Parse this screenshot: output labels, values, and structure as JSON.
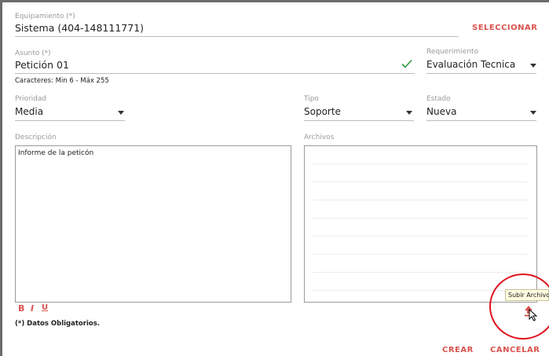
{
  "equipamiento": {
    "label": "Equipamiento (*)",
    "value": "Sistema (404-148111771)",
    "select_label": "SELECCIONAR"
  },
  "asunto": {
    "label": "Asunto (*)",
    "value": "Petición 01",
    "hint": "Caracteres: Min 6 - Máx 255"
  },
  "requerimiento": {
    "label": "Requerimiento",
    "value": "Evaluación Tecnica"
  },
  "prioridad": {
    "label": "Prioridad",
    "value": "Media"
  },
  "tipo": {
    "label": "Tipo",
    "value": "Soporte"
  },
  "estado": {
    "label": "Estado",
    "value": "Nueva"
  },
  "descripcion": {
    "label": "Descripción",
    "value": "Informe de la peticón"
  },
  "format": {
    "bold": "B",
    "italic": "I",
    "underline": "U"
  },
  "archivos": {
    "label": "Archivos"
  },
  "upload": {
    "tooltip": "Subir Archivo"
  },
  "footer": {
    "required_note": "(*) Datos Obligatorios.",
    "create_label": "CREAR",
    "cancel_label": "CANCELAR"
  },
  "colors": {
    "accent": "#d9534f",
    "check": "#2e9e3a",
    "highlight": "#e0141e"
  }
}
